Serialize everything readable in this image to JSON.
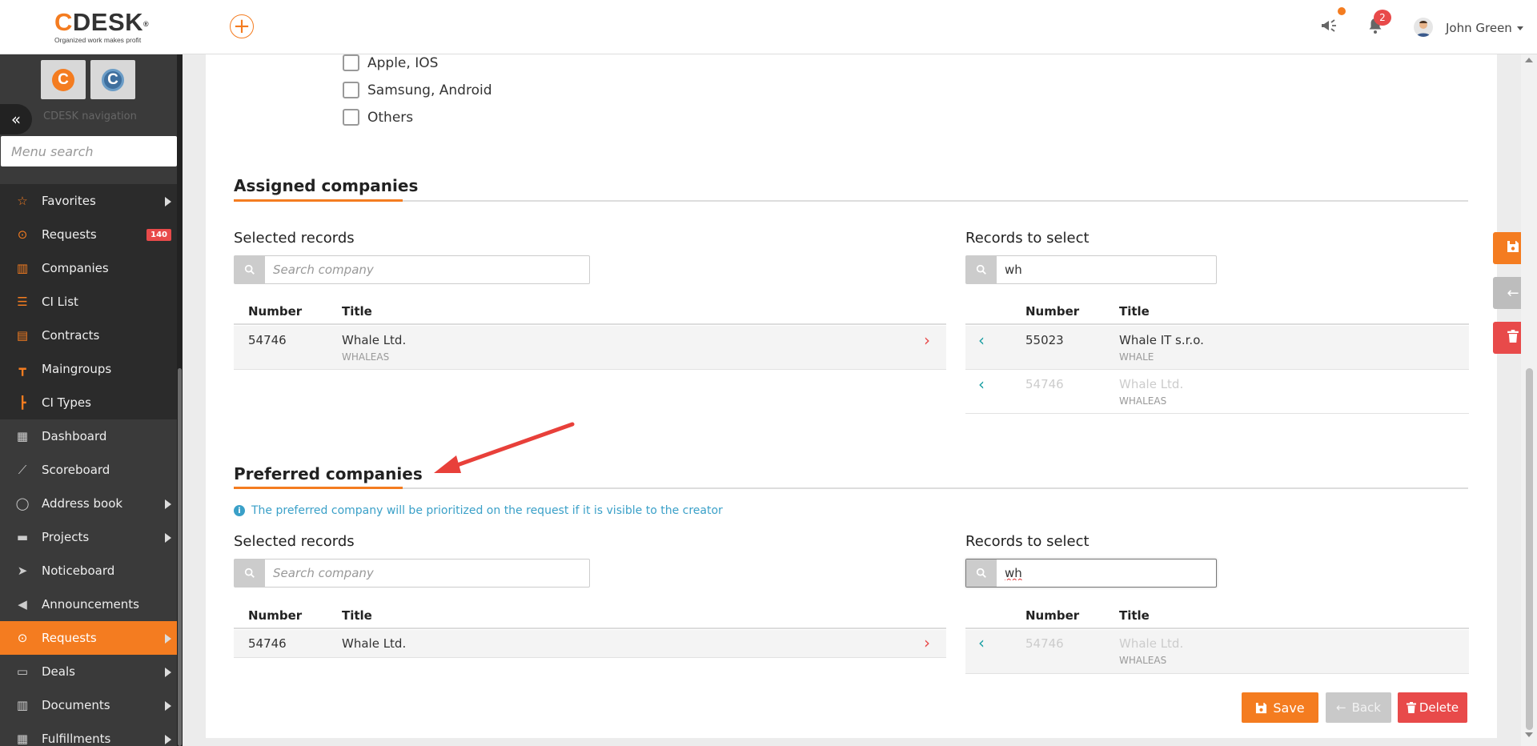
{
  "header": {
    "logo_text": "DESK",
    "logo_c": "C",
    "logo_tagline": "Organized work makes profit",
    "add_icon": "plus-circle-icon",
    "notification_count": "2",
    "user_name": "John Green"
  },
  "sidebar": {
    "nav_title": "CDESK navigation",
    "search_placeholder": "Menu search",
    "items": [
      {
        "label": "Favorites",
        "icon": "star-icon",
        "glyph": "☆",
        "arrow": true,
        "style": "dark"
      },
      {
        "label": "Requests",
        "icon": "requests-icon",
        "glyph": "⊙",
        "badge": "140",
        "style": "dark"
      },
      {
        "label": "Companies",
        "icon": "building-icon",
        "glyph": "▥",
        "style": "dark"
      },
      {
        "label": "CI List",
        "icon": "list-icon",
        "glyph": "☰",
        "style": "dark"
      },
      {
        "label": "Contracts",
        "icon": "contract-icon",
        "glyph": "▤",
        "style": "dark"
      },
      {
        "label": "Maingroups",
        "icon": "tree-icon",
        "glyph": "┳",
        "style": "dark"
      },
      {
        "label": "CI Types",
        "icon": "hierarchy-icon",
        "glyph": "┣",
        "style": "dark"
      },
      {
        "label": "Dashboard",
        "icon": "dashboard-icon",
        "glyph": "▦",
        "style": "normal"
      },
      {
        "label": "Scoreboard",
        "icon": "chart-line-icon",
        "glyph": "⟋",
        "style": "normal"
      },
      {
        "label": "Address book",
        "icon": "user-icon",
        "glyph": "◯",
        "arrow": true,
        "style": "normal"
      },
      {
        "label": "Projects",
        "icon": "folder-icon",
        "glyph": "▬",
        "arrow": true,
        "style": "normal"
      },
      {
        "label": "Noticeboard",
        "icon": "paper-plane-icon",
        "glyph": "➤",
        "style": "normal"
      },
      {
        "label": "Announcements",
        "icon": "megaphone-icon",
        "glyph": "◀",
        "style": "normal"
      },
      {
        "label": "Requests",
        "icon": "requests-icon",
        "glyph": "⊙",
        "arrow": true,
        "style": "active"
      },
      {
        "label": "Deals",
        "icon": "credit-card-icon",
        "glyph": "▭",
        "arrow": true,
        "style": "normal"
      },
      {
        "label": "Documents",
        "icon": "books-icon",
        "glyph": "▥",
        "arrow": true,
        "style": "normal"
      },
      {
        "label": "Fulfillments",
        "icon": "fulfillment-icon",
        "glyph": "▦",
        "arrow": true,
        "style": "normal"
      }
    ]
  },
  "checkboxes": [
    "Apple, IOS",
    "Samsung, Android",
    "Others"
  ],
  "assigned": {
    "title": "Assigned companies",
    "selected_label": "Selected records",
    "select_label": "Records to select",
    "selected_search_placeholder": "Search company",
    "select_search_value": "wh",
    "col_number": "Number",
    "col_title": "Title",
    "selected_rows": [
      {
        "number": "54746",
        "title": "Whale Ltd.",
        "code": "WHALEAS"
      }
    ],
    "select_rows": [
      {
        "number": "55023",
        "title": "Whale IT s.r.o.",
        "code": "WHALE"
      },
      {
        "number": "54746",
        "title": "Whale Ltd.",
        "code": "WHALEAS"
      }
    ]
  },
  "preferred": {
    "title": "Preferred companies",
    "info": "The preferred company will be prioritized on the request if it is visible to the creator",
    "selected_label": "Selected records",
    "select_label": "Records to select",
    "selected_search_placeholder": "Search company",
    "select_search_value": "wh",
    "col_number": "Number",
    "col_title": "Title",
    "selected_rows": [
      {
        "number": "54746",
        "title": "Whale Ltd."
      }
    ],
    "select_rows": [
      {
        "number": "54746",
        "title": "Whale Ltd.",
        "code": "WHALEAS"
      }
    ]
  },
  "actions": {
    "save": "Save",
    "back": "Back",
    "delete": "Delete"
  },
  "colors": {
    "accent": "#f47c20",
    "danger": "#e84a4a",
    "info": "#3aa0c8",
    "sidebar": "#3a3a3a"
  }
}
